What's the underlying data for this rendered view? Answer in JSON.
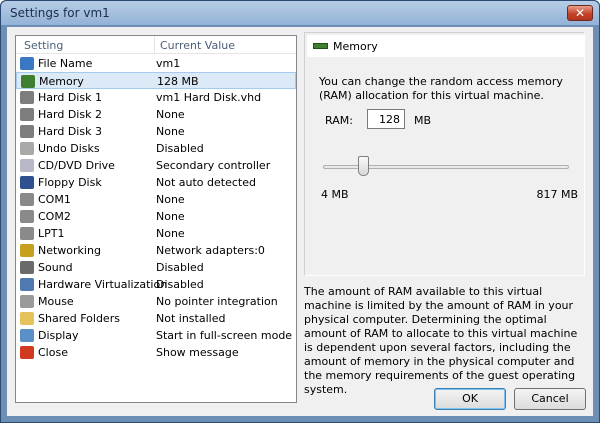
{
  "window": {
    "title": "Settings for vm1"
  },
  "list": {
    "columns": [
      "Setting",
      "Current Value"
    ],
    "selected_index": 1,
    "rows": [
      {
        "name": "File Name",
        "value": "vm1",
        "icon": "info-icon",
        "color": "#3a78c4"
      },
      {
        "name": "Memory",
        "value": "128 MB",
        "icon": "memory-icon",
        "color": "#3f7f2f"
      },
      {
        "name": "Hard Disk 1",
        "value": "vm1 Hard Disk.vhd",
        "icon": "hard-disk-icon",
        "color": "#7d7d7d"
      },
      {
        "name": "Hard Disk 2",
        "value": "None",
        "icon": "hard-disk-icon",
        "color": "#7d7d7d"
      },
      {
        "name": "Hard Disk 3",
        "value": "None",
        "icon": "hard-disk-icon",
        "color": "#7d7d7d"
      },
      {
        "name": "Undo Disks",
        "value": "Disabled",
        "icon": "undo-disk-icon",
        "color": "#a9a9a9"
      },
      {
        "name": "CD/DVD Drive",
        "value": "Secondary controller",
        "icon": "cd-icon",
        "color": "#b8b8c8"
      },
      {
        "name": "Floppy Disk",
        "value": "Not auto detected",
        "icon": "floppy-icon",
        "color": "#2f4f8f"
      },
      {
        "name": "COM1",
        "value": "None",
        "icon": "com-port-icon",
        "color": "#8a8a8a"
      },
      {
        "name": "COM2",
        "value": "None",
        "icon": "com-port-icon",
        "color": "#8a8a8a"
      },
      {
        "name": "LPT1",
        "value": "None",
        "icon": "lpt-port-icon",
        "color": "#8a8a8a"
      },
      {
        "name": "Networking",
        "value": "Network adapters:0",
        "icon": "network-icon",
        "color": "#c8a020"
      },
      {
        "name": "Sound",
        "value": "Disabled",
        "icon": "sound-icon",
        "color": "#6a6a6a"
      },
      {
        "name": "Hardware Virtualization",
        "value": "Disabled",
        "icon": "hardware-virtualization-icon",
        "color": "#4f7ab0"
      },
      {
        "name": "Mouse",
        "value": "No pointer integration",
        "icon": "mouse-icon",
        "color": "#9a9a9a"
      },
      {
        "name": "Shared Folders",
        "value": "Not installed",
        "icon": "folder-icon",
        "color": "#e6c25a"
      },
      {
        "name": "Display",
        "value": "Start in full-screen mode",
        "icon": "display-icon",
        "color": "#5b8fc8"
      },
      {
        "name": "Close",
        "value": "Show message",
        "icon": "close-power-icon",
        "color": "#d23a1f"
      }
    ]
  },
  "panel": {
    "title": "Memory",
    "description": "You can change the random access memory (RAM) allocation for this virtual machine.",
    "ram_label": "RAM:",
    "ram_value": "128",
    "ram_unit": "MB",
    "slider_min": "4 MB",
    "slider_max": "817 MB",
    "slider_fraction": 0.152
  },
  "info": "The amount of RAM available to this virtual machine is limited by the amount of RAM in your physical computer. Determining the optimal amount of RAM to allocate to this virtual machine is dependent upon several factors, including the amount of memory in the physical computer and the memory requirements of the guest operating system.",
  "buttons": {
    "ok": "OK",
    "cancel": "Cancel"
  },
  "colors": {
    "accent": "#3c7fb1",
    "selection": "#dce9f7",
    "close": "#c5432a"
  }
}
